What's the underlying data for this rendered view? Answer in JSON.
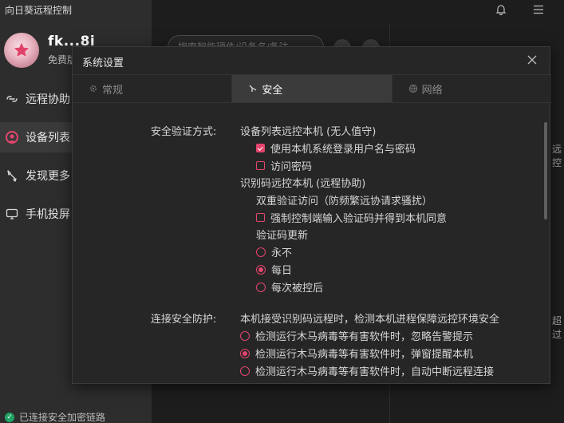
{
  "app": {
    "title": "向日葵远程控制"
  },
  "user": {
    "name": "fk...8i",
    "plan": "免费版"
  },
  "sidebar": {
    "items": [
      {
        "label": "远程协助",
        "icon": "remote-assist-icon",
        "active": false
      },
      {
        "label": "设备列表",
        "icon": "device-list-icon",
        "active": true
      },
      {
        "label": "发现更多",
        "icon": "discover-icon",
        "active": false
      },
      {
        "label": "手机投屏",
        "icon": "screen-cast-icon",
        "active": false
      }
    ],
    "status": "已连接安全加密链路"
  },
  "background": {
    "search_placeholder": "搜索智能硬件/设备名/备注",
    "fragment_1": "远控",
    "fragment_2": "超过"
  },
  "dialog": {
    "title": "系统设置",
    "tabs": [
      {
        "label": "常规",
        "icon": "gear-icon",
        "active": false
      },
      {
        "label": "安全",
        "icon": "security-icon",
        "active": true
      },
      {
        "label": "网络",
        "icon": "network-icon",
        "active": false
      }
    ],
    "security": {
      "label": "安全验证方式:",
      "device_list_heading": "设备列表远控本机 (无人值守)",
      "use_system_login": {
        "label": "使用本机系统登录用户名与密码",
        "checked": true
      },
      "access_password": {
        "label": "访问密码",
        "checked": false
      },
      "id_code_heading": "识别码远控本机 (远程协助)",
      "dual_verify_heading": "双重验证访问（防频繁远协请求骚扰）",
      "force_verify": {
        "label": "强制控制端输入验证码并得到本机同意",
        "checked": false
      },
      "code_update_heading": "验证码更新",
      "code_update_options": [
        {
          "label": "永不",
          "selected": false
        },
        {
          "label": "每日",
          "selected": true
        },
        {
          "label": "每次被控后",
          "selected": false
        }
      ]
    },
    "protection": {
      "label": "连接安全防护:",
      "description": "本机接受识别码远程时，检测本机进程保障远控环境安全",
      "options": [
        {
          "label": "检测运行木马病毒等有害软件时，忽略告警提示",
          "selected": false
        },
        {
          "label": "检测运行木马病毒等有害软件时，弹窗提醒本机",
          "selected": true
        },
        {
          "label": "检测运行木马病毒等有害软件时，自动中断远程连接",
          "selected": false
        }
      ]
    }
  },
  "colors": {
    "accent": "#e5456d",
    "sidebar_bg": "#2d2d2d",
    "dialog_bg": "#262626",
    "active_tab_bg": "#3b3b3b",
    "status_green": "#21a366"
  }
}
